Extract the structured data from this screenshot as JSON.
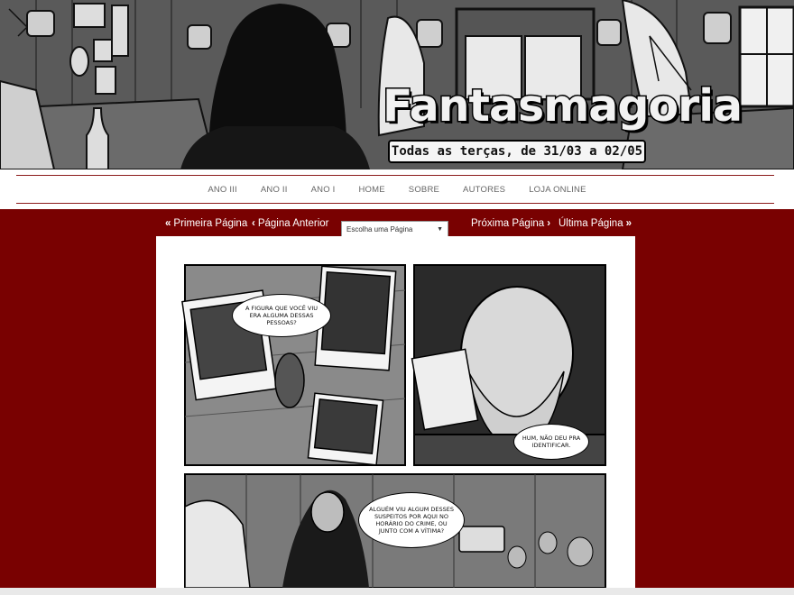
{
  "banner": {
    "logo_text": "Fantasmagoria",
    "tagline": "Todas as terças, de 31/03 a 02/05"
  },
  "nav": {
    "items": [
      {
        "label": "ANO III"
      },
      {
        "label": "ANO II"
      },
      {
        "label": "ANO I"
      },
      {
        "label": "HOME"
      },
      {
        "label": "SOBRE"
      },
      {
        "label": "AUTORES"
      },
      {
        "label": "LOJA ONLINE"
      }
    ]
  },
  "pager": {
    "first": "Primeira Página",
    "prev": "Página Anterior",
    "select_placeholder": "Escolha uma Página",
    "next": "Próxima Página",
    "last": "Última Página",
    "icons": {
      "first": "double-chevron-left-icon",
      "prev": "chevron-left-icon",
      "next": "chevron-right-icon",
      "last": "double-chevron-right-icon"
    }
  },
  "comic": {
    "bubbles": {
      "panel1": "A figura que você viu era alguma dessas pessoas?",
      "panel2": "Hum, não deu pra identificar.",
      "panel3": "Alguém viu algum desses suspeitos por aqui no horário do crime, ou junto com a vítima?"
    }
  },
  "colors": {
    "maroon": "#790101",
    "nav_line": "#8b1a1a",
    "nav_text": "#666666"
  }
}
